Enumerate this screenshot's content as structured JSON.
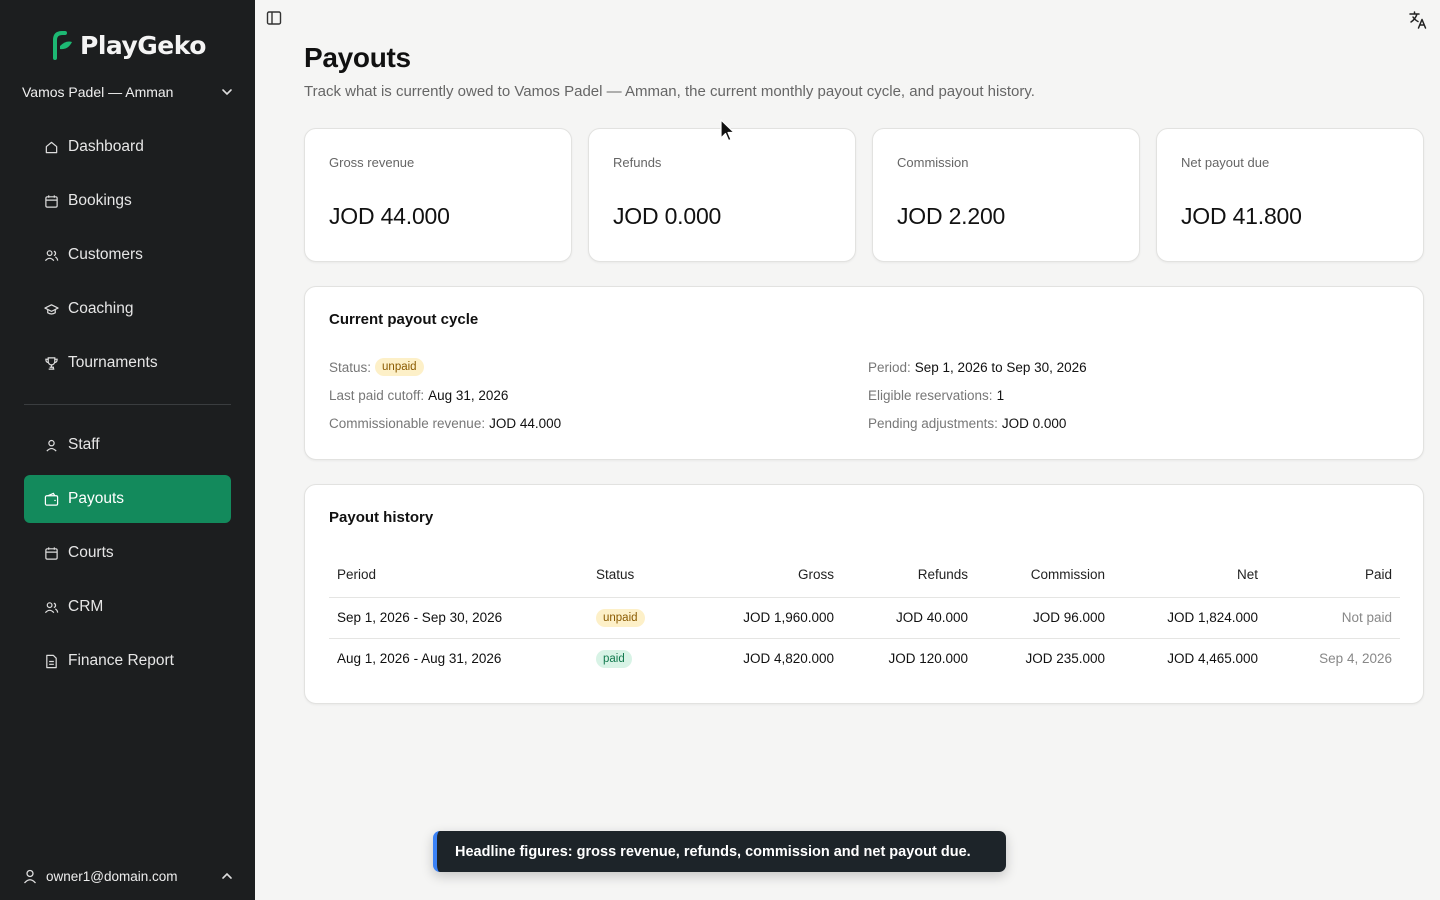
{
  "brand": {
    "name": "PlayGeko",
    "accent": "#138a5c"
  },
  "venue": {
    "name": "Vamos Padel — Amman"
  },
  "nav": {
    "items": [
      {
        "label": "Dashboard",
        "icon": "home-icon"
      },
      {
        "label": "Bookings",
        "icon": "calendar-icon"
      },
      {
        "label": "Customers",
        "icon": "users-icon"
      },
      {
        "label": "Coaching",
        "icon": "graduation-cap-icon"
      },
      {
        "label": "Tournaments",
        "icon": "trophy-icon"
      }
    ],
    "items2": [
      {
        "label": "Staff",
        "icon": "user-icon"
      },
      {
        "label": "Payouts",
        "icon": "wallet-icon",
        "active": true
      },
      {
        "label": "Courts",
        "icon": "calendar-icon"
      },
      {
        "label": "CRM",
        "icon": "users-icon"
      },
      {
        "label": "Finance Report",
        "icon": "file-icon"
      }
    ]
  },
  "user": {
    "email": "owner1@domain.com"
  },
  "page": {
    "title": "Payouts",
    "subtitle": "Track what is currently owed to Vamos Padel — Amman, the current monthly payout cycle, and payout history."
  },
  "stats": [
    {
      "label": "Gross revenue",
      "value": "JOD 44.000"
    },
    {
      "label": "Refunds",
      "value": "JOD 0.000"
    },
    {
      "label": "Commission",
      "value": "JOD 2.200"
    },
    {
      "label": "Net payout due",
      "value": "JOD 41.800"
    }
  ],
  "cycle": {
    "title": "Current payout cycle",
    "status_label": "Status:",
    "status_value": "unpaid",
    "last_paid_label": "Last paid cutoff:",
    "last_paid_value": "Aug 31, 2026",
    "commissionable_label": "Commissionable revenue:",
    "commissionable_value": "JOD 44.000",
    "period_label": "Period:",
    "period_value": "Sep 1, 2026 to Sep 30, 2026",
    "eligible_label": "Eligible reservations:",
    "eligible_value": "1",
    "pending_label": "Pending adjustments:",
    "pending_value": "JOD 0.000"
  },
  "history": {
    "title": "Payout history",
    "columns": [
      "Period",
      "Status",
      "Gross",
      "Refunds",
      "Commission",
      "Net",
      "Paid"
    ],
    "rows": [
      [
        "Sep 1, 2026 - Sep 30, 2026",
        "unpaid",
        "JOD 1,960.000",
        "JOD 40.000",
        "JOD 96.000",
        "JOD 1,824.000",
        "Not paid"
      ],
      [
        "Aug 1, 2026 - Aug 31, 2026",
        "paid",
        "JOD 4,820.000",
        "JOD 120.000",
        "JOD 235.000",
        "JOD 4,465.000",
        "Sep 4, 2026"
      ]
    ]
  },
  "toast": {
    "message": "Headline figures: gross revenue, refunds, commission and net payout due."
  }
}
